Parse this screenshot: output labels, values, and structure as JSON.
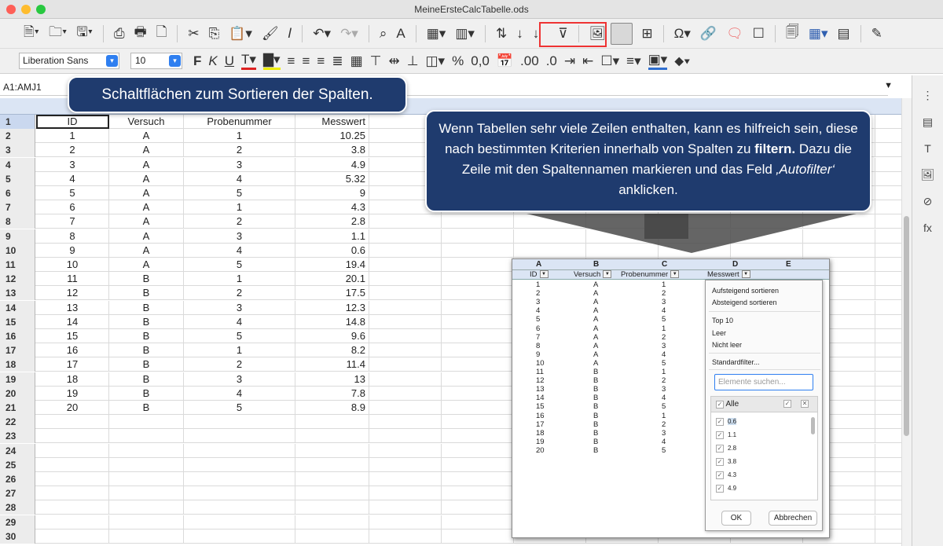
{
  "window": {
    "title": "MeineErsteCalcTabelle.ods"
  },
  "format": {
    "font": "Liberation Sans",
    "size": "10"
  },
  "namebox": {
    "value": "A1:AMJ1"
  },
  "headers": [
    "ID",
    "Versuch",
    "Probenummer",
    "Messwert"
  ],
  "rows": [
    [
      "1",
      "A",
      "1",
      "10.25"
    ],
    [
      "2",
      "A",
      "2",
      "3.8"
    ],
    [
      "3",
      "A",
      "3",
      "4.9"
    ],
    [
      "4",
      "A",
      "4",
      "5.32"
    ],
    [
      "5",
      "A",
      "5",
      "9"
    ],
    [
      "6",
      "A",
      "1",
      "4.3"
    ],
    [
      "7",
      "A",
      "2",
      "2.8"
    ],
    [
      "8",
      "A",
      "3",
      "1.1"
    ],
    [
      "9",
      "A",
      "4",
      "0.6"
    ],
    [
      "10",
      "A",
      "5",
      "19.4"
    ],
    [
      "11",
      "B",
      "1",
      "20.1"
    ],
    [
      "12",
      "B",
      "2",
      "17.5"
    ],
    [
      "13",
      "B",
      "3",
      "12.3"
    ],
    [
      "14",
      "B",
      "4",
      "14.8"
    ],
    [
      "15",
      "B",
      "5",
      "9.6"
    ],
    [
      "16",
      "B",
      "1",
      "8.2"
    ],
    [
      "17",
      "B",
      "2",
      "11.4"
    ],
    [
      "18",
      "B",
      "3",
      "13"
    ],
    [
      "19",
      "B",
      "4",
      "7.8"
    ],
    [
      "20",
      "B",
      "5",
      "8.9"
    ]
  ],
  "row_numbers": [
    "1",
    "2",
    "3",
    "4",
    "5",
    "6",
    "7",
    "8",
    "9",
    "10",
    "11",
    "12",
    "13",
    "14",
    "15",
    "16",
    "17",
    "18",
    "19",
    "20",
    "21",
    "22",
    "23",
    "24",
    "25",
    "26",
    "27",
    "28",
    "29",
    "30"
  ],
  "callout1": {
    "text": "Schaltflächen zum Sortieren der Spalten."
  },
  "callout2": {
    "line1": "Wenn Tabellen sehr viele Zeilen enthalten, kann es hilfreich sein, diese nach bestimmten Kriterien innerhalb von Spalten zu",
    "bold": "filtern.",
    "line2": "Dazu die Zeile mit den Spaltennamen markieren und das Feld",
    "italic": "‚Autofilter‘",
    "line3": "anklicken."
  },
  "inset": {
    "col_letters": [
      "A",
      "B",
      "C",
      "D",
      "E"
    ],
    "headers": [
      "ID",
      "Versuch",
      "Probenummer",
      "Messwert"
    ],
    "menu": {
      "sort_asc": "Aufsteigend sortieren",
      "sort_desc": "Absteigend sortieren",
      "top10": "Top 10",
      "empty": "Leer",
      "not_empty": "Nicht leer",
      "std_filter": "Standardfilter...",
      "search_placeholder": "Elemente suchen...",
      "all": "Alle",
      "values": [
        "0.6",
        "1.1",
        "2.8",
        "3.8",
        "4.3",
        "4.9"
      ],
      "ok": "OK",
      "cancel": "Abbrechen"
    }
  },
  "colors": {
    "accent": "#1f3b6e",
    "highlight": "#e33333"
  }
}
